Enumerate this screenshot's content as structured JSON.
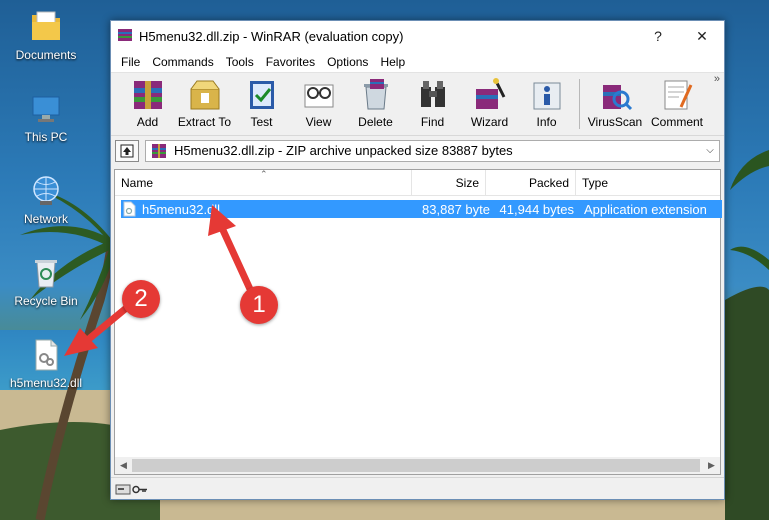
{
  "desktop": {
    "icons": [
      {
        "label": "Documents",
        "icon": "folder-icon"
      },
      {
        "label": "This PC",
        "icon": "computer-icon"
      },
      {
        "label": "Network",
        "icon": "network-icon"
      },
      {
        "label": "Recycle Bin",
        "icon": "recycle-bin-icon"
      },
      {
        "label": "h5menu32.dll",
        "icon": "dll-file-icon"
      }
    ]
  },
  "window": {
    "title": "H5menu32.dll.zip - WinRAR (evaluation copy)",
    "help_label": "?",
    "close_label": "✕"
  },
  "menu": [
    "File",
    "Commands",
    "Tools",
    "Favorites",
    "Options",
    "Help"
  ],
  "toolbar": {
    "buttons": [
      {
        "label": "Add",
        "icon": "add-archive-icon"
      },
      {
        "label": "Extract To",
        "icon": "extract-icon"
      },
      {
        "label": "Test",
        "icon": "test-icon"
      },
      {
        "label": "View",
        "icon": "view-icon"
      },
      {
        "label": "Delete",
        "icon": "delete-icon"
      },
      {
        "label": "Find",
        "icon": "find-icon"
      },
      {
        "label": "Wizard",
        "icon": "wizard-icon"
      },
      {
        "label": "Info",
        "icon": "info-icon"
      },
      {
        "label": "VirusScan",
        "icon": "virusscan-icon"
      },
      {
        "label": "Comment",
        "icon": "comment-icon"
      }
    ],
    "more": "»"
  },
  "address": {
    "text": "H5menu32.dll.zip - ZIP archive unpacked size 83887 bytes"
  },
  "columns": [
    "Name",
    "Size",
    "Packed",
    "Type"
  ],
  "files": [
    {
      "name": "h5menu32.dll",
      "size": "83,887 byte",
      "packed": "41,944 bytes",
      "type": "Application extension"
    }
  ],
  "annotations": {
    "badge1": "1",
    "badge2": "2"
  },
  "colors": {
    "selection": "#3399ff",
    "badge": "#e53935"
  }
}
